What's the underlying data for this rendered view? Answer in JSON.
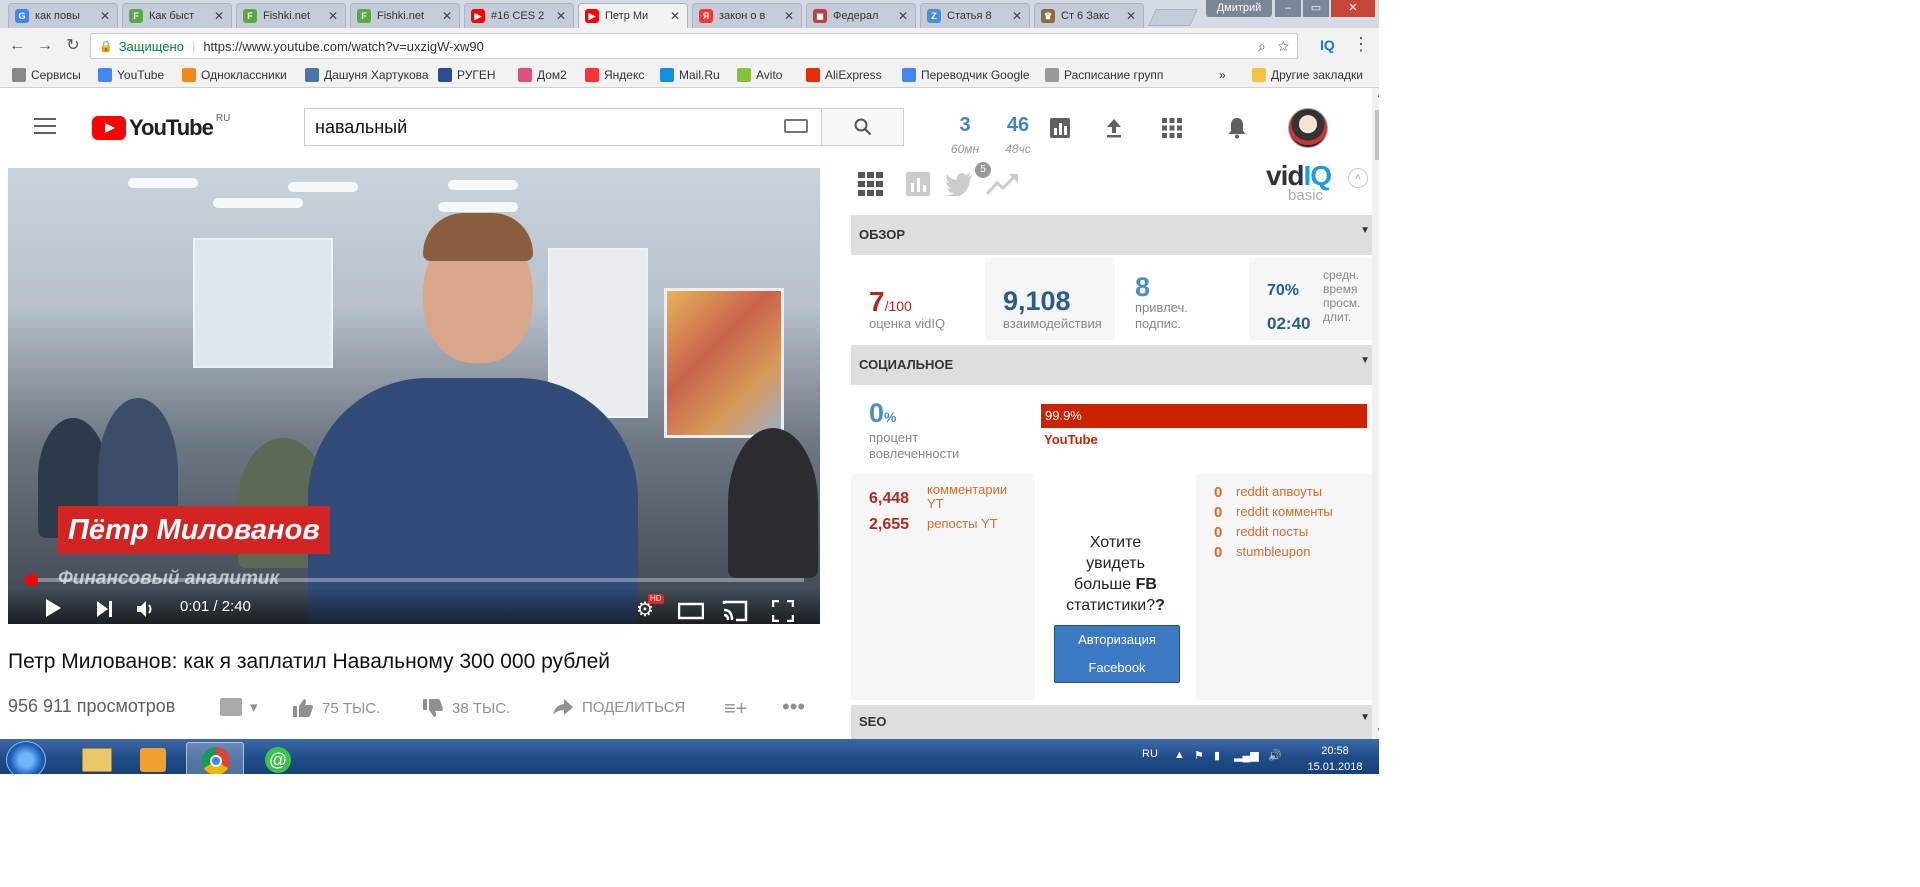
{
  "browser": {
    "tabs": [
      {
        "title": "как повы",
        "icon": "G",
        "color": "#4285f4"
      },
      {
        "title": "Как быст",
        "icon": "F",
        "color": "#5aa844"
      },
      {
        "title": "Fishki.net",
        "icon": "F",
        "color": "#5aa844"
      },
      {
        "title": "Fishki.net",
        "icon": "F",
        "color": "#5aa844"
      },
      {
        "title": "#16 CES 2",
        "icon": "▶",
        "color": "#ff0000"
      },
      {
        "title": "Петр Ми",
        "icon": "▶",
        "color": "#ff0000"
      },
      {
        "title": "закон о в",
        "icon": "Я",
        "color": "#ff3333"
      },
      {
        "title": "Федерал",
        "icon": "◼",
        "color": "#c04040"
      },
      {
        "title": "Статья 8",
        "icon": "Z",
        "color": "#4b8fd6"
      },
      {
        "title": "Ст 6 Закс",
        "icon": "♛",
        "color": "#8a6d3b"
      }
    ],
    "active_tab_index": 5,
    "user": "Дмитрий",
    "secure_label": "Защищено",
    "url": "https://www.youtube.com/watch?v=uxzigW-xw90",
    "extension_label": "IQ",
    "bookmarks": [
      {
        "label": "Сервисы",
        "icon": "grid-icon",
        "color": "#888"
      },
      {
        "label": "YouTube",
        "icon": "google-icon",
        "color": "#4285f4"
      },
      {
        "label": "Одноклассники",
        "icon": "ok-icon",
        "color": "#f28a1b"
      },
      {
        "label": "Дашуня Хартукова",
        "icon": "vk-icon",
        "color": "#4a76a8"
      },
      {
        "label": "РУГЕН",
        "icon": "24-icon",
        "color": "#2a4e8f"
      },
      {
        "label": "Дом2",
        "icon": "flower-icon",
        "color": "#e04e7a"
      },
      {
        "label": "Яндекс",
        "icon": "yandex-icon",
        "color": "#ff3333"
      },
      {
        "label": "Mail.Ru",
        "icon": "mail-icon",
        "color": "#168de2"
      },
      {
        "label": "Avito",
        "icon": "avito-icon",
        "color": "#86c239"
      },
      {
        "label": "AliExpress",
        "icon": "ali-icon",
        "color": "#e62e04"
      },
      {
        "label": "Переводчик Google",
        "icon": "translate-icon",
        "color": "#4285f4"
      },
      {
        "label": "Расписание групп",
        "icon": "doc-icon",
        "color": "#999"
      }
    ],
    "bookmarks_more": "»",
    "other_bookmarks": "Другие закладки"
  },
  "youtube": {
    "logo_text": "YouTube",
    "logo_region": "RU",
    "search_value": "навальный",
    "stats": [
      {
        "value": "3",
        "label": "60мн"
      },
      {
        "value": "46",
        "label": "48чс"
      }
    ],
    "video": {
      "title": "Петр Милованов: как я заплатил Навальному 300 000 рублей",
      "lower_third_name": "Пётр Милованов",
      "lower_third_role": "Финансовый аналитик",
      "time": "0:01 / 2:40",
      "progress": 0.01,
      "views": "956 911 просмотров",
      "likes": "75 ТЫС.",
      "dislikes": "38 ТЫС.",
      "share": "ПОДЕЛИТЬСЯ",
      "hd_badge": "HD"
    }
  },
  "vidiq": {
    "logo_vid": "vid",
    "logo_iq": "IQ",
    "plan": "basic",
    "twitter_badge": "5",
    "overview": {
      "heading": "ОБЗОР",
      "score_value": "7",
      "score_max": "/100",
      "score_label": "оценка vidIQ",
      "interactions_value": "9,108",
      "interactions_label": "взаимодействия",
      "subs_value": "8",
      "subs_label_1": "привлеч.",
      "subs_label_2": "подпис.",
      "retention_pct": "70%",
      "retention_time": "02:40",
      "retention_label_1": "средн.",
      "retention_label_2": "время",
      "retention_label_3": "просм.",
      "retention_label_4": "длит."
    },
    "social": {
      "heading": "СОЦИАЛЬНОЕ",
      "engagement_value": "0",
      "engagement_unit": "%",
      "engagement_label_1": "процент",
      "engagement_label_2": "вовлеченности",
      "youtube_share": "99.9%",
      "youtube_share_fraction": 0.999,
      "youtube_label": "YouTube",
      "comments_value": "6,448",
      "comments_label_1": "комментарии",
      "comments_label_2": "YT",
      "reposts_value": "2,655",
      "reposts_label": "репосты YT",
      "fb_prompt_1": "Хотите",
      "fb_prompt_2": "увидеть",
      "fb_prompt_3a": "больше ",
      "fb_prompt_3b": "FB",
      "fb_prompt_4a": "статистики?",
      "fb_prompt_4b": "?",
      "fb_button_1": "Авторизация",
      "fb_button_2": "Facebook",
      "reddit": [
        {
          "value": "0",
          "label": "reddit апвоуты"
        },
        {
          "value": "0",
          "label": "reddit комменты"
        },
        {
          "value": "0",
          "label": "reddit посты"
        },
        {
          "value": "0",
          "label": "stumbleupon"
        }
      ]
    },
    "seo_heading": "SEO"
  },
  "taskbar": {
    "language": "RU",
    "time": "20:58",
    "date": "15.01.2018"
  }
}
